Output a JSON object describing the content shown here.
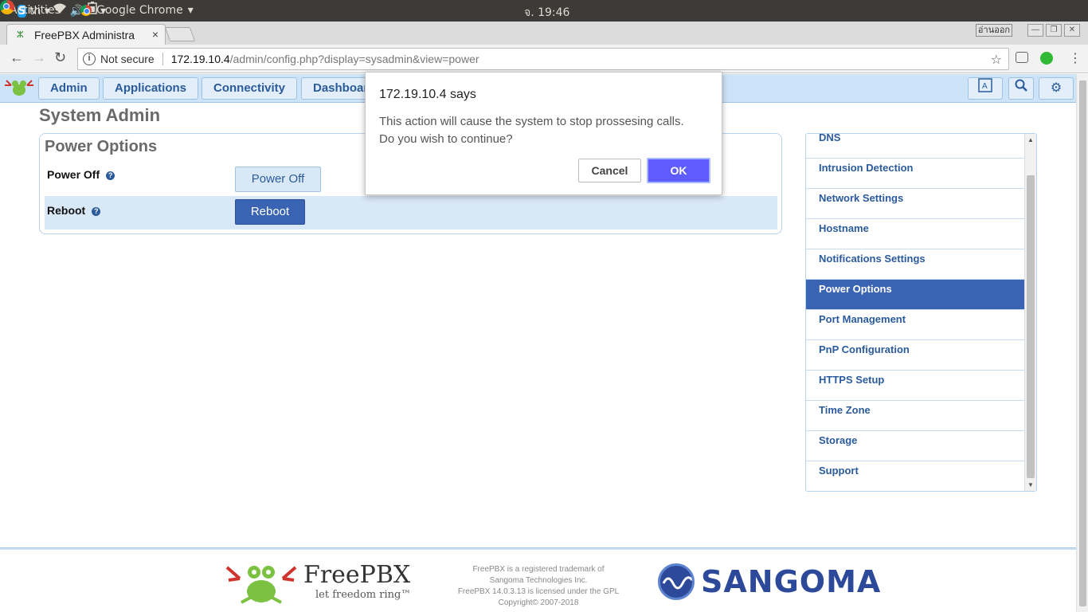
{
  "topbar": {
    "activities": "Activities",
    "app": "Google Chrome",
    "clock": "จ. 19:46",
    "lang": "th"
  },
  "tab": {
    "title": "FreePBX Administra",
    "close": "×"
  },
  "window": {
    "lang_badge": "อ่านออก"
  },
  "omnibox": {
    "security": "Not secure",
    "host": "172.19.10.4",
    "path": "/admin/config.php?display=sysadmin&view=power"
  },
  "nav": {
    "items": [
      "Admin",
      "Applications",
      "Connectivity",
      "Dashboard"
    ]
  },
  "page": {
    "title": "System Admin",
    "panel_title": "Power Options",
    "power_off_label": "Power Off",
    "power_off_button": "Power Off",
    "reboot_label": "Reboot",
    "reboot_button": "Reboot"
  },
  "sidebar": {
    "items": [
      {
        "label": "DNS"
      },
      {
        "label": "Intrusion Detection"
      },
      {
        "label": "Network Settings"
      },
      {
        "label": "Hostname"
      },
      {
        "label": "Notifications Settings"
      },
      {
        "label": "Power Options",
        "active": true
      },
      {
        "label": "Port Management"
      },
      {
        "label": "PnP Configuration"
      },
      {
        "label": "HTTPS Setup"
      },
      {
        "label": "Time Zone"
      },
      {
        "label": "Storage"
      },
      {
        "label": "Support"
      }
    ]
  },
  "footer": {
    "brand": "FreePBX",
    "tagline": "let freedom ring™",
    "legal": [
      "FreePBX is a registered trademark of",
      "Sangoma Technologies Inc.",
      "FreePBX 14.0.3.13 is licensed under the GPL",
      "Copyright© 2007-2018"
    ],
    "sangoma": "SANGOMA"
  },
  "dialog": {
    "title": "172.19.10.4 says",
    "line1": "This action will cause the system to stop prossesing calls.",
    "line2": "Do you wish to continue?",
    "cancel": "Cancel",
    "ok": "OK"
  },
  "colors": {
    "nav_bg": "#cde3f7",
    "accent": "#3a63b3",
    "dialog_ok": "#5f5cff"
  }
}
